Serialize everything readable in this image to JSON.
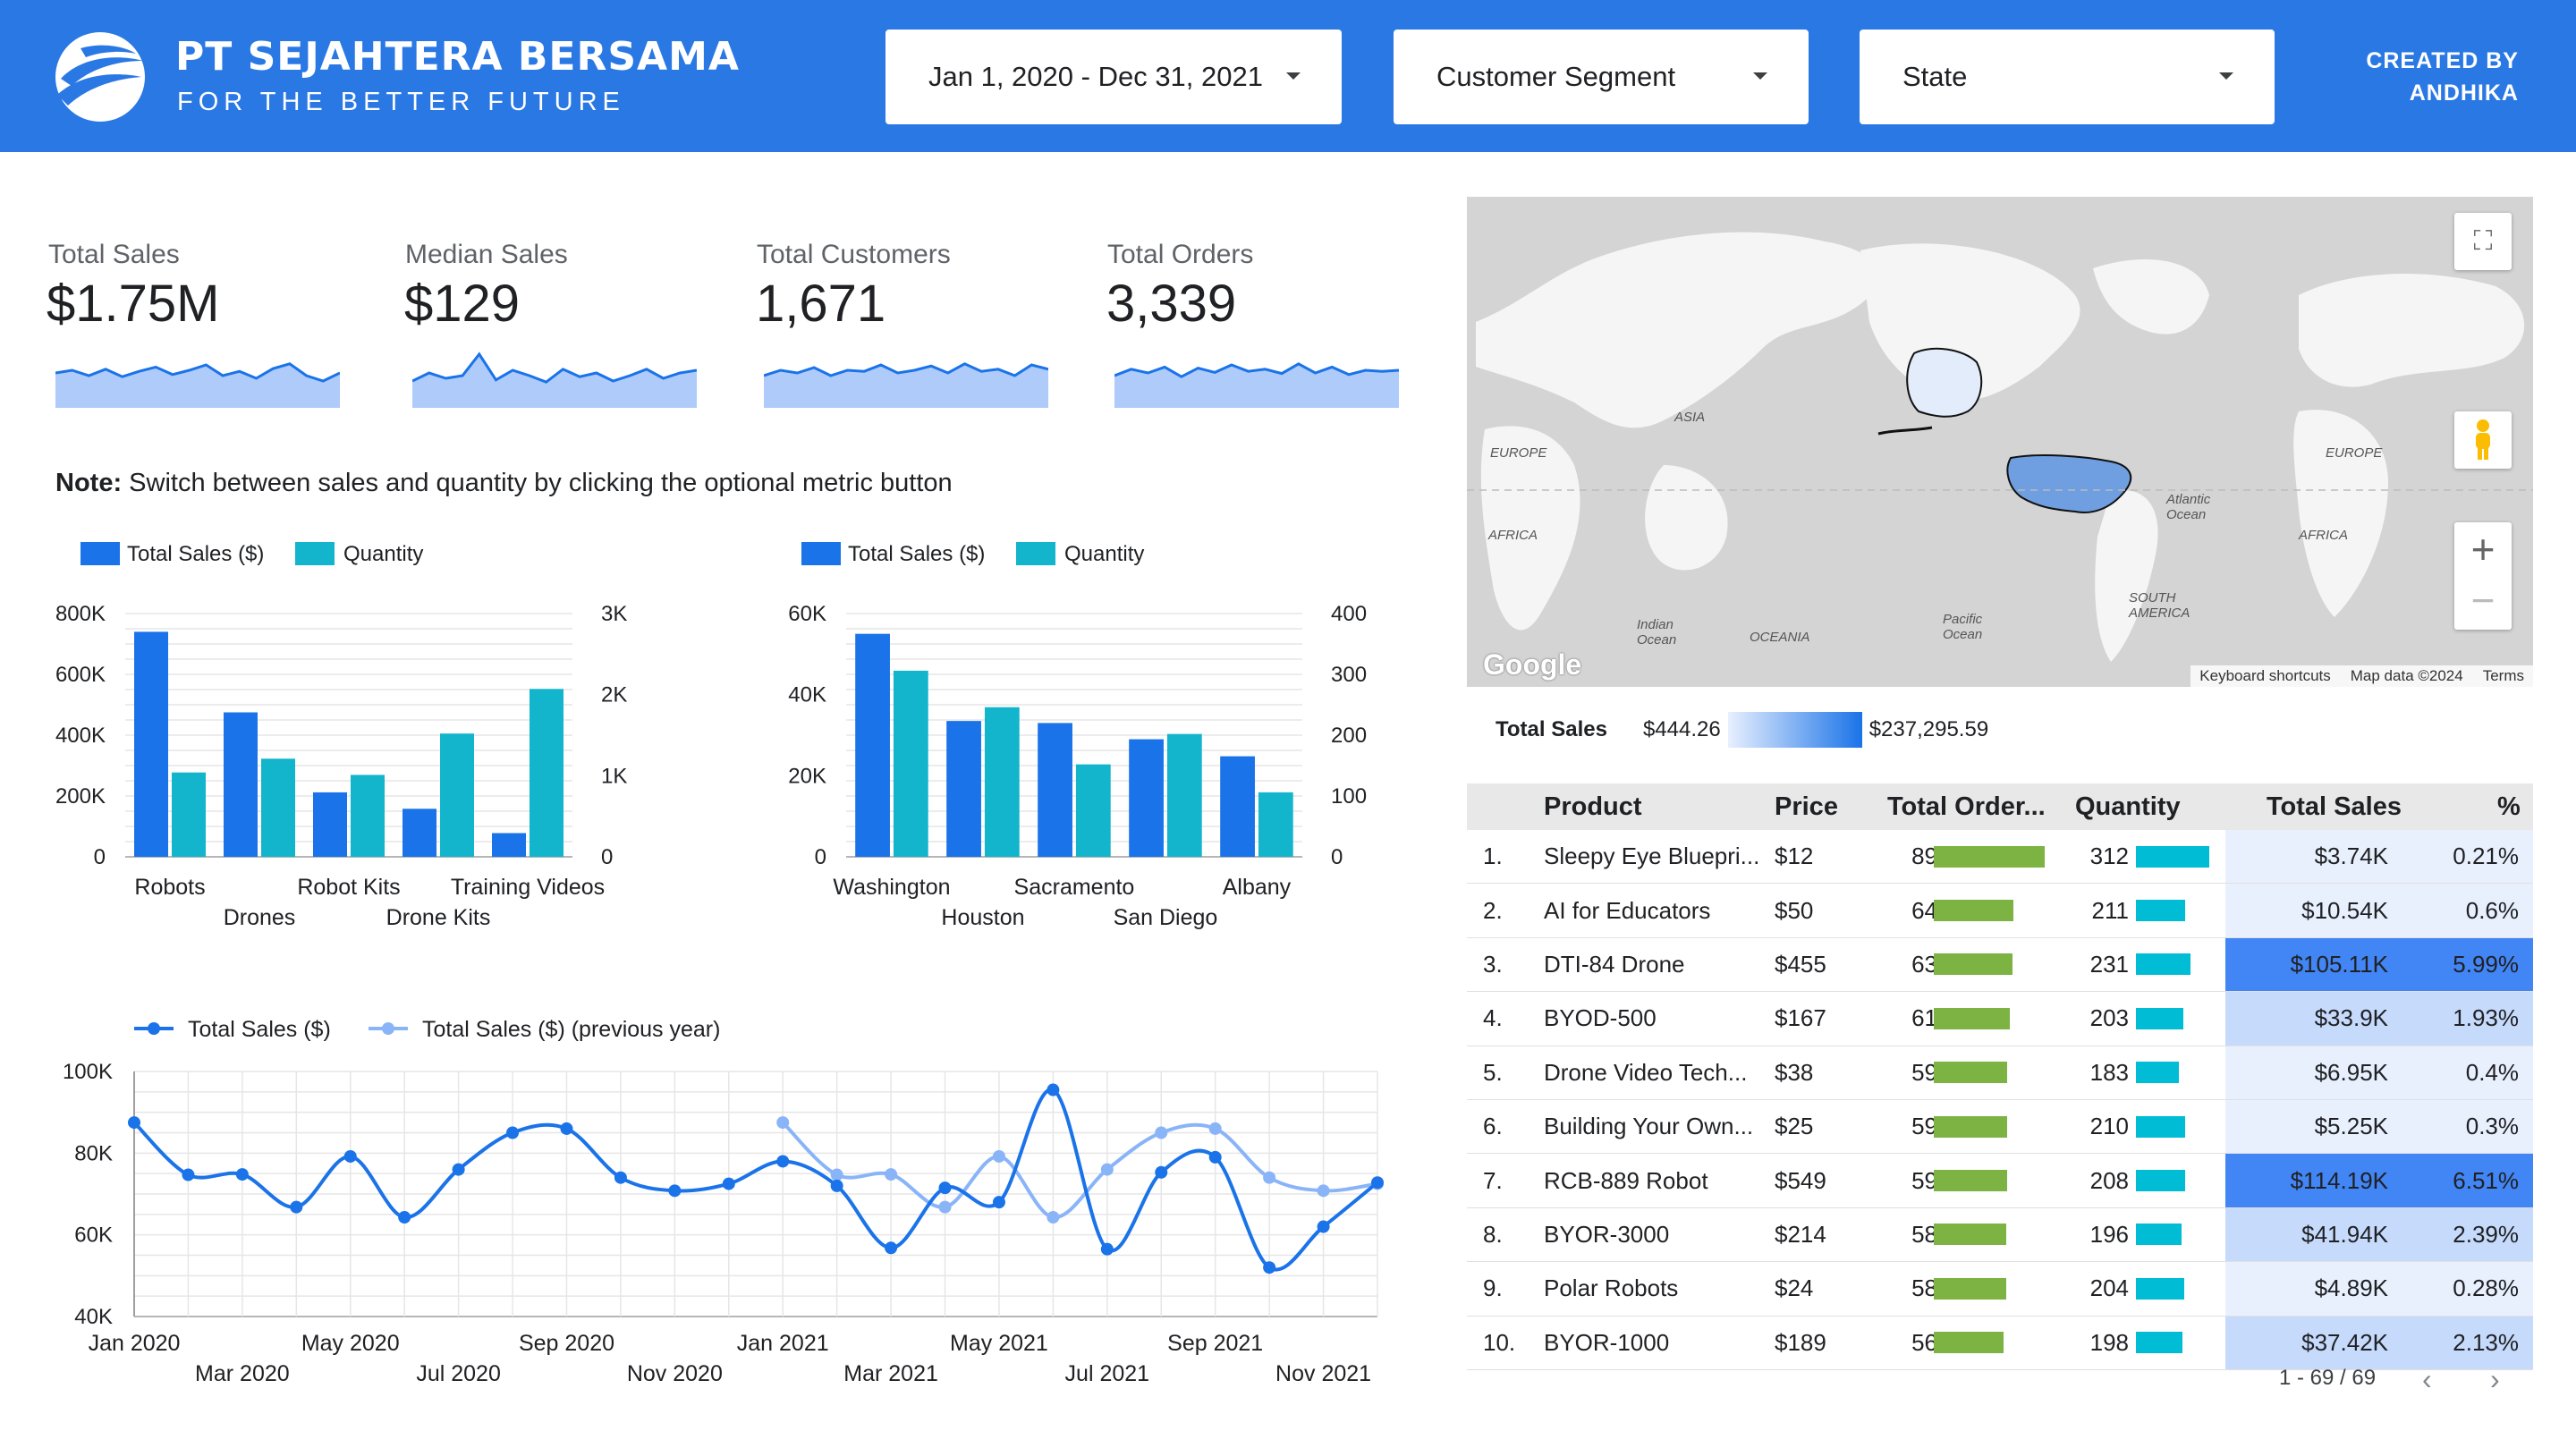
{
  "header": {
    "brand": "PT SEJAHTERA BERSAMA",
    "tagline": "FOR THE BETTER FUTURE",
    "date_filter": "Jan 1, 2020 - Dec 31, 2021",
    "segment_filter": "Customer Segment",
    "state_filter": "State",
    "created_line1": "CREATED BY",
    "created_line2": "ANDHIKA",
    "colors": {
      "header_bg": "#2a78e4"
    }
  },
  "kpis": [
    {
      "label": "Total Sales",
      "value": "$1.75M",
      "trend": [
        0.55,
        0.6,
        0.5,
        0.62,
        0.48,
        0.58,
        0.66,
        0.52,
        0.6,
        0.7,
        0.5,
        0.58,
        0.45,
        0.63,
        0.72,
        0.5,
        0.4,
        0.55
      ]
    },
    {
      "label": "Median Sales",
      "value": "$129",
      "trend": [
        0.4,
        0.55,
        0.45,
        0.5,
        0.9,
        0.42,
        0.6,
        0.5,
        0.38,
        0.62,
        0.48,
        0.55,
        0.4,
        0.5,
        0.62,
        0.45,
        0.55,
        0.6
      ]
    },
    {
      "label": "Total Customers",
      "value": "1,671",
      "trend": [
        0.5,
        0.6,
        0.55,
        0.65,
        0.5,
        0.6,
        0.58,
        0.7,
        0.55,
        0.6,
        0.68,
        0.55,
        0.72,
        0.58,
        0.62,
        0.5,
        0.7,
        0.62
      ]
    },
    {
      "label": "Total Orders",
      "value": "3,339",
      "trend": [
        0.5,
        0.62,
        0.55,
        0.66,
        0.48,
        0.64,
        0.56,
        0.7,
        0.58,
        0.62,
        0.54,
        0.72,
        0.55,
        0.66,
        0.52,
        0.6,
        0.58,
        0.6
      ]
    }
  ],
  "note": {
    "bold": "Note:",
    "text": " Switch between sales and quantity by clicking the optional metric button"
  },
  "chart_data": [
    {
      "type": "bar",
      "categories": [
        "Robots",
        "Drones",
        "Robot Kits",
        "Drone Kits",
        "Training Videos"
      ],
      "series": [
        {
          "name": "Total Sales ($)",
          "values": [
            740000,
            475000,
            212000,
            158000,
            78000
          ],
          "axis": "left",
          "color": "#1a73e8"
        },
        {
          "name": "Quantity",
          "values": [
            1040,
            1210,
            1010,
            1520,
            2070
          ],
          "axis": "right",
          "color": "#12b5cb"
        }
      ],
      "ylim_left": [
        0,
        800000
      ],
      "ylim_right": [
        0,
        3000
      ],
      "left_ticks": [
        "0",
        "200K",
        "400K",
        "600K",
        "800K"
      ],
      "right_ticks": [
        "0",
        "1K",
        "2K",
        "3K"
      ],
      "legend": "top-left"
    },
    {
      "type": "bar",
      "categories": [
        "Washington",
        "Houston",
        "Sacramento",
        "San Diego",
        "Albany"
      ],
      "series": [
        {
          "name": "Total Sales ($)",
          "values": [
            55000,
            33500,
            33000,
            29000,
            24800
          ],
          "axis": "left",
          "color": "#1a73e8"
        },
        {
          "name": "Quantity",
          "values": [
            306,
            246,
            152,
            202,
            106
          ],
          "axis": "right",
          "color": "#12b5cb"
        }
      ],
      "ylim_left": [
        0,
        60000
      ],
      "ylim_right": [
        0,
        400
      ],
      "left_ticks": [
        "0",
        "20K",
        "40K",
        "60K"
      ],
      "right_ticks": [
        "0",
        "100",
        "200",
        "300",
        "400"
      ],
      "legend": "top-left"
    },
    {
      "type": "line",
      "x": [
        "Jan 2020",
        "Feb 2020",
        "Mar 2020",
        "Apr 2020",
        "May 2020",
        "Jun 2020",
        "Jul 2020",
        "Aug 2020",
        "Sep 2020",
        "Oct 2020",
        "Nov 2020",
        "Dec 2020",
        "Jan 2021",
        "Feb 2021",
        "Mar 2021",
        "Apr 2021",
        "May 2021",
        "Jun 2021",
        "Jul 2021",
        "Aug 2021",
        "Sep 2021",
        "Oct 2021",
        "Nov 2021",
        "Dec 2021"
      ],
      "x_tick_labels": [
        "Jan 2020",
        "Mar 2020",
        "May 2020",
        "Jul 2020",
        "Sep 2020",
        "Nov 2020",
        "Jan 2021",
        "Mar 2021",
        "May 2021",
        "Jul 2021",
        "Sep 2021",
        "Nov 2021"
      ],
      "series": [
        {
          "name": "Total Sales ($)",
          "color": "#1a73e8",
          "values": [
            87500,
            74700,
            74800,
            66800,
            79200,
            64300,
            76000,
            85000,
            86000,
            74000,
            70800,
            72500,
            78000,
            72000,
            56800,
            71500,
            68000,
            95500,
            56500,
            75300,
            79000,
            52000,
            62000,
            72800
          ]
        },
        {
          "name": "Total Sales ($) (previous year)",
          "color": "#8ab4f8",
          "values": [
            null,
            null,
            null,
            null,
            null,
            null,
            null,
            null,
            null,
            null,
            null,
            null,
            87500,
            74700,
            74800,
            66800,
            79200,
            64300,
            76000,
            85000,
            86000,
            74000,
            70800,
            72500
          ]
        }
      ],
      "ylim": [
        40000,
        100000
      ],
      "y_ticks": [
        "40K",
        "60K",
        "80K",
        "100K"
      ],
      "grid": true,
      "legend": "top-left"
    }
  ],
  "map": {
    "labels": {
      "asia": "ASIA",
      "europe_l": "EUROPE",
      "europe_r": "EUROPE",
      "africa_l": "AFRICA",
      "africa_r": "AFRICA",
      "oceania": "OCEANIA",
      "south_america": "SOUTH AMERICA",
      "atlantic": "Atlantic Ocean",
      "pacific": "Pacific Ocean",
      "indian": "Indian Ocean"
    },
    "google": "Google",
    "footer": {
      "shortcuts": "Keyboard shortcuts",
      "mapdata": "Map data ©2024",
      "terms": "Terms"
    },
    "legend_title": "Total Sales",
    "legend_min": "$444.26",
    "legend_max": "$237,295.59"
  },
  "table": {
    "headers": {
      "product": "Product",
      "price": "Price",
      "orders": "Total Order...",
      "quantity": "Quantity",
      "sales": "Total Sales",
      "pct": "%"
    },
    "rows": [
      {
        "n": "1.",
        "product": "Sleepy Eye Bluepri...",
        "price": "$12",
        "orders": "89",
        "quantity": "312",
        "sales": "$3.74K",
        "pct": "0.21%",
        "orders_fill": 1.0,
        "qty_fill": 1.0,
        "sales_fill": 0.03
      },
      {
        "n": "2.",
        "product": "AI for Educators",
        "price": "$50",
        "orders": "64",
        "quantity": "211",
        "sales": "$10.54K",
        "pct": "0.6%",
        "orders_fill": 0.72,
        "qty_fill": 0.676,
        "sales_fill": 0.09
      },
      {
        "n": "3.",
        "product": "DTI-84 Drone",
        "price": "$455",
        "orders": "63",
        "quantity": "231",
        "sales": "$105.11K",
        "pct": "5.99%",
        "orders_fill": 0.708,
        "qty_fill": 0.74,
        "sales_fill": 0.92
      },
      {
        "n": "4.",
        "product": "BYOD-500",
        "price": "$167",
        "orders": "61",
        "quantity": "203",
        "sales": "$33.9K",
        "pct": "1.93%",
        "orders_fill": 0.685,
        "qty_fill": 0.65,
        "sales_fill": 0.3
      },
      {
        "n": "5.",
        "product": "Drone Video Tech...",
        "price": "$38",
        "orders": "59",
        "quantity": "183",
        "sales": "$6.95K",
        "pct": "0.4%",
        "orders_fill": 0.663,
        "qty_fill": 0.587,
        "sales_fill": 0.06
      },
      {
        "n": "6.",
        "product": "Building Your Own...",
        "price": "$25",
        "orders": "59",
        "quantity": "210",
        "sales": "$5.25K",
        "pct": "0.3%",
        "orders_fill": 0.663,
        "qty_fill": 0.673,
        "sales_fill": 0.045
      },
      {
        "n": "7.",
        "product": "RCB-889 Robot",
        "price": "$549",
        "orders": "59",
        "quantity": "208",
        "sales": "$114.19K",
        "pct": "6.51%",
        "orders_fill": 0.663,
        "qty_fill": 0.667,
        "sales_fill": 1.0
      },
      {
        "n": "8.",
        "product": "BYOR-3000",
        "price": "$214",
        "orders": "58",
        "quantity": "196",
        "sales": "$41.94K",
        "pct": "2.39%",
        "orders_fill": 0.652,
        "qty_fill": 0.628,
        "sales_fill": 0.37
      },
      {
        "n": "9.",
        "product": "Polar Robots",
        "price": "$24",
        "orders": "58",
        "quantity": "204",
        "sales": "$4.89K",
        "pct": "0.28%",
        "orders_fill": 0.652,
        "qty_fill": 0.654,
        "sales_fill": 0.04
      },
      {
        "n": "10.",
        "product": "BYOR-1000",
        "price": "$189",
        "orders": "56",
        "quantity": "198",
        "sales": "$37.42K",
        "pct": "2.13%",
        "orders_fill": 0.63,
        "qty_fill": 0.635,
        "sales_fill": 0.33
      }
    ],
    "pager": "1 - 69 / 69"
  }
}
